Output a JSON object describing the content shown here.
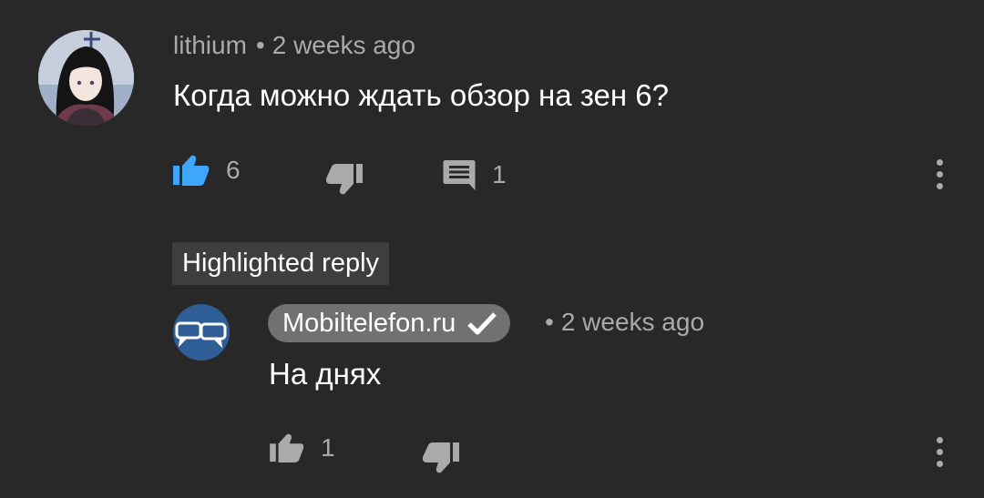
{
  "comment": {
    "author": "lithium",
    "separator": "•",
    "time": "2 weeks ago",
    "text": "Когда можно ждать обзор на зен 6?",
    "like_count": "6",
    "reply_count": "1",
    "like_active": true
  },
  "highlight_label": "Highlighted reply",
  "reply": {
    "author": "Mobiltelefon.ru",
    "verified": true,
    "separator": "•",
    "time": "2 weeks ago",
    "text": "На днях",
    "like_count": "1"
  },
  "colors": {
    "background": "#282828",
    "active_like": "#3ea6ff",
    "secondary_text": "#aaaaaa",
    "icon": "#aaaaaa",
    "channel_chip": "#717171",
    "reply_avatar": "#2f5e97"
  }
}
